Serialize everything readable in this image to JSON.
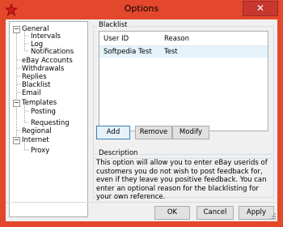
{
  "window": {
    "title": "Options",
    "close_label": "✕"
  },
  "tree": {
    "items": [
      {
        "label": "General",
        "expander": "−"
      },
      {
        "label": "Intervals"
      },
      {
        "label": "Log"
      },
      {
        "label": "Notifications"
      },
      {
        "label": "eBay Accounts"
      },
      {
        "label": "Withdrawals"
      },
      {
        "label": "Replies"
      },
      {
        "label": "Blacklist"
      },
      {
        "label": "Email"
      },
      {
        "label": "Templates",
        "expander": "−"
      },
      {
        "label": "Posting"
      },
      {
        "label": "Requesting"
      },
      {
        "label": "Regional"
      },
      {
        "label": "Internet",
        "expander": "−"
      },
      {
        "label": "Proxy"
      }
    ]
  },
  "blacklist": {
    "group_label": "Blacklist",
    "columns": [
      "User ID",
      "Reason"
    ],
    "rows": [
      {
        "user_id": "Softpedia Test",
        "reason": "Test"
      }
    ],
    "buttons": {
      "add": "Add",
      "remove": "Remove",
      "modify": "Modify"
    }
  },
  "description": {
    "group_label": "Description",
    "text": "This option will allow you to enter eBay userids of customers you do not wish to post feedback for, even if they leave you positive feedback.  You can enter an optional reason for the blacklisting for your own reference."
  },
  "footer": {
    "ok": "OK",
    "cancel": "Cancel",
    "apply": "Apply"
  },
  "colors": {
    "titlebar": "#e4482c",
    "close_button": "#c7372f",
    "selection": "#e5f3fb"
  }
}
